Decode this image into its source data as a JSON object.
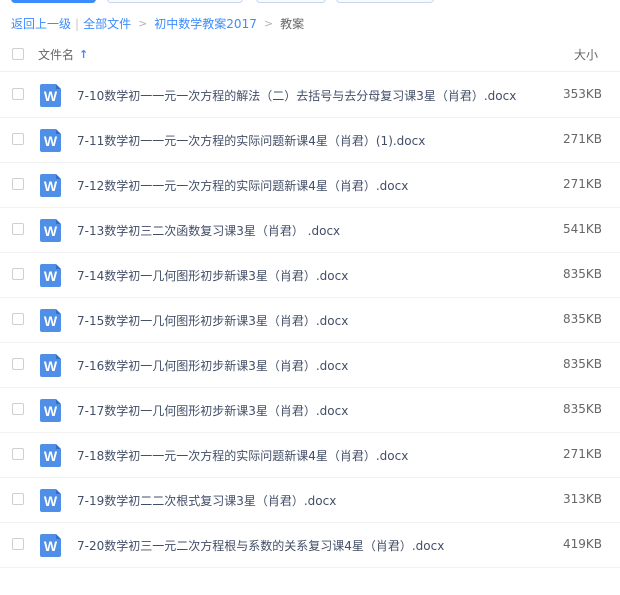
{
  "breadcrumb": {
    "back_label": "返回上一级",
    "separator": "|",
    "crumbs": [
      "全部文件",
      "初中数学教案2017",
      "教案"
    ],
    "arrow": ">"
  },
  "header": {
    "name_label": "文件名",
    "sort_glyph": "↑",
    "size_label": "大小"
  },
  "file_icon": {
    "glyph": "W",
    "name": "word-doc-icon",
    "color": "#4f8fe8"
  },
  "accent_color": "#3b8cff",
  "files": [
    {
      "name": "7-10数学初一一元一次方程的解法（二）去括号与去分母复习课3星（肖君）.docx",
      "size": "353KB"
    },
    {
      "name": "7-11数学初一一元一次方程的实际问题新课4星（肖君）(1).docx",
      "size": "271KB"
    },
    {
      "name": "7-12数学初一一元一次方程的实际问题新课4星（肖君）.docx",
      "size": "271KB"
    },
    {
      "name": "7-13数学初三二次函数复习课3星（肖君） .docx",
      "size": "541KB"
    },
    {
      "name": "7-14数学初一几何图形初步新课3星（肖君）.docx",
      "size": "835KB"
    },
    {
      "name": "7-15数学初一几何图形初步新课3星（肖君）.docx",
      "size": "835KB"
    },
    {
      "name": "7-16数学初一几何图形初步新课3星（肖君）.docx",
      "size": "835KB"
    },
    {
      "name": "7-17数学初一几何图形初步新课3星（肖君）.docx",
      "size": "835KB"
    },
    {
      "name": "7-18数学初一一元一次方程的实际问题新课4星（肖君）.docx",
      "size": "271KB"
    },
    {
      "name": "7-19数学初二二次根式复习课3星（肖君）.docx",
      "size": "313KB"
    },
    {
      "name": "7-20数学初三一元二次方程根与系数的关系复习课4星（肖君）.docx",
      "size": "419KB"
    }
  ]
}
